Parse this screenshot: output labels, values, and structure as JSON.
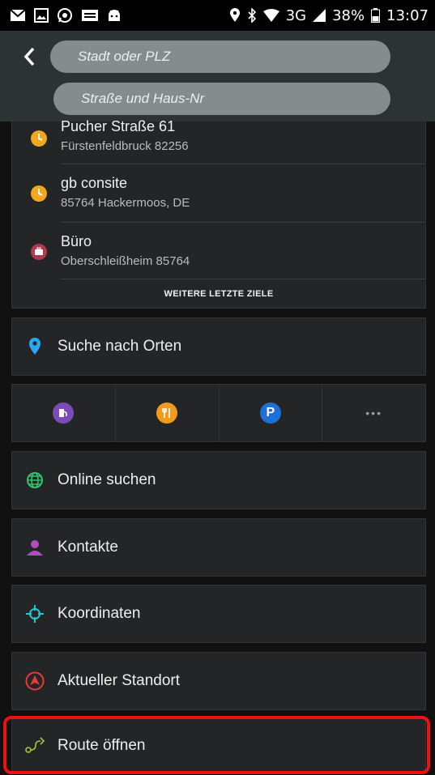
{
  "status_bar": {
    "network": "3G",
    "battery": "38%",
    "time": "13:07"
  },
  "header": {
    "city_placeholder": "Stadt oder PLZ",
    "street_placeholder": "Straße und Haus-Nr"
  },
  "recent": {
    "items": [
      {
        "title": "Pucher Straße 61",
        "subtitle": "Fürstenfeldbruck 82256",
        "icon": "clock-icon"
      },
      {
        "title": "gb consite",
        "subtitle": "85764 Hackermoos, DE",
        "icon": "clock-icon"
      },
      {
        "title": "Büro",
        "subtitle": "Oberschleißheim 85764",
        "icon": "briefcase-icon"
      }
    ],
    "more_label": "WEITERE LETZTE ZIELE"
  },
  "search_places": {
    "label": "Suche nach Orten",
    "icon": "location-pin-icon"
  },
  "categories": [
    {
      "icon": "fuel-icon",
      "color": "#7b4bb8"
    },
    {
      "icon": "restaurant-icon",
      "color": "#f29a1a"
    },
    {
      "icon": "parking-icon",
      "color": "#1e6fd6",
      "glyph": "P"
    },
    {
      "icon": "more-icon",
      "glyph": "•••"
    }
  ],
  "menu": [
    {
      "label": "Online suchen",
      "icon": "globe-icon"
    },
    {
      "label": "Kontakte",
      "icon": "person-icon"
    },
    {
      "label": "Koordinaten",
      "icon": "crosshair-icon"
    },
    {
      "label": "Aktueller Standort",
      "icon": "navigation-arrow-icon"
    },
    {
      "label": "Route öffnen",
      "icon": "route-icon"
    }
  ],
  "colors": {
    "highlight": "#ee1111",
    "accent_blue": "#29a8ef",
    "clock_orange": "#f2a81d"
  }
}
